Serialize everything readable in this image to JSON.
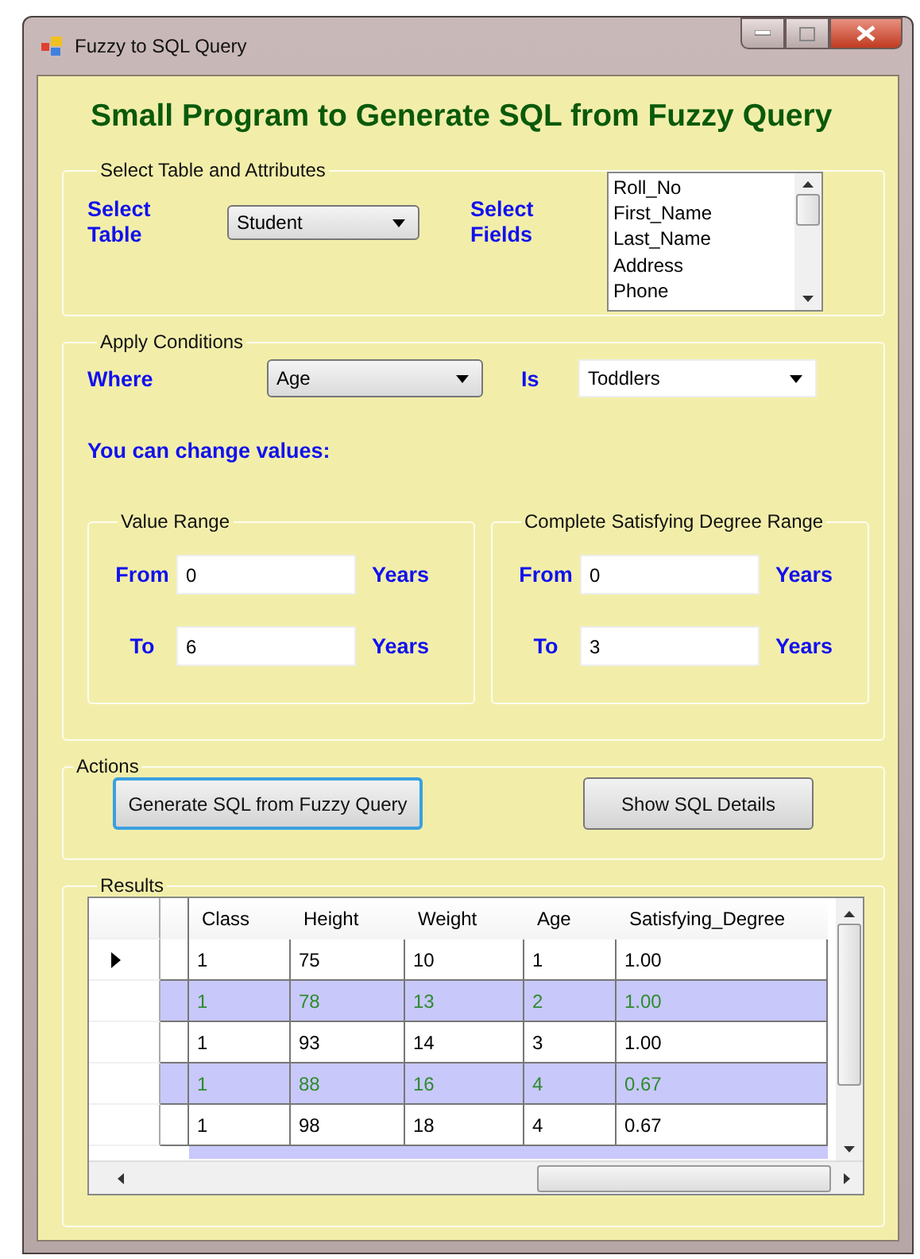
{
  "window": {
    "title": "Fuzzy to SQL Query"
  },
  "heading": "Small Program to Generate SQL from Fuzzy Query",
  "select_group": {
    "title": "Select Table and Attributes",
    "table_label": "Select Table",
    "table_value": "Student",
    "fields_label": "Select Fields",
    "fields": [
      "Roll_No",
      "First_Name",
      "Last_Name",
      "Address",
      "Phone"
    ]
  },
  "conditions_group": {
    "title": "Apply Conditions",
    "where_label": "Where",
    "where_value": "Age",
    "is_label": "Is",
    "is_value": "Toddlers",
    "hint": "You can change values:",
    "ranges": [
      {
        "title": "Value Range",
        "from_label": "From",
        "from_value": "0",
        "to_label": "To",
        "to_value": "6",
        "unit_from": "Years",
        "unit_to": "Years"
      },
      {
        "title": "Complete Satisfying Degree Range",
        "from_label": "From",
        "from_value": "0",
        "to_label": "To",
        "to_value": "3",
        "unit_from": "Years",
        "unit_to": "Years"
      }
    ]
  },
  "actions_group": {
    "title": "Actions",
    "buttons": [
      {
        "label": "Generate SQL from Fuzzy Query",
        "focused": true
      },
      {
        "label": "Show SQL Details",
        "focused": false
      }
    ]
  },
  "results_group": {
    "title": "Results",
    "table": {
      "columns": [
        "Class",
        "Height",
        "Weight",
        "Age",
        "Satisfying_Degree"
      ],
      "rows": [
        {
          "current": true,
          "shaded": false,
          "cells": [
            "1",
            "75",
            "10",
            "1",
            "1.00"
          ]
        },
        {
          "current": false,
          "shaded": true,
          "cells": [
            "1",
            "78",
            "13",
            "2",
            "1.00"
          ]
        },
        {
          "current": false,
          "shaded": false,
          "cells": [
            "1",
            "93",
            "14",
            "3",
            "1.00"
          ]
        },
        {
          "current": false,
          "shaded": true,
          "cells": [
            "1",
            "88",
            "16",
            "4",
            "0.67"
          ]
        },
        {
          "current": false,
          "shaded": false,
          "cells": [
            "1",
            "98",
            "18",
            "4",
            "0.67"
          ]
        }
      ]
    }
  }
}
